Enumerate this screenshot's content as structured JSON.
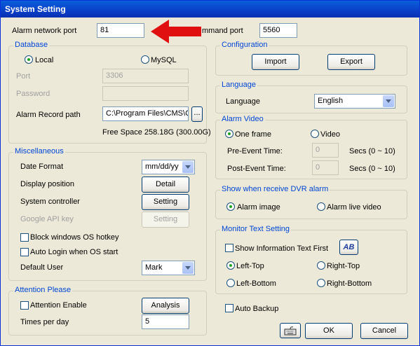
{
  "window": {
    "title": "System Setting"
  },
  "alarm_port": {
    "label": "Alarm network port",
    "value": "81"
  },
  "command_port": {
    "label": "mmand port",
    "value": "5560"
  },
  "database": {
    "title": "Database",
    "local_label": "Local",
    "mysql_label": "MySQL",
    "port_label": "Port",
    "port_value": "3306",
    "password_label": "Password",
    "record_path_label": "Alarm Record path",
    "record_path_value": "C:\\Program Files\\CMS\\CM",
    "browse_label": "...",
    "free_space": "Free Space 258.18G (300.00G)"
  },
  "misc": {
    "title": "Miscellaneous",
    "date_format_label": "Date Format",
    "date_format_value": "mm/dd/yy",
    "display_position_label": "Display position",
    "detail_button": "Detail",
    "system_controller_label": "System controller",
    "setting_button": "Setting",
    "google_api_label": "Google API key",
    "google_setting_button": "Setting",
    "block_hotkey_label": "Block windows OS hotkey",
    "auto_login_label": "Auto Login when OS start",
    "default_user_label": "Default User",
    "default_user_value": "Mark"
  },
  "attention": {
    "title": "Attention Please",
    "enable_label": "Attention Enable",
    "analysis_button": "Analysis",
    "times_label": "Times per day",
    "times_value": "5"
  },
  "configuration": {
    "title": "Configuration",
    "import_button": "Import",
    "export_button": "Export"
  },
  "language": {
    "title": "Language",
    "label": "Language",
    "value": "English"
  },
  "alarm_video": {
    "title": "Alarm Video",
    "one_frame_label": "One frame",
    "video_label": "Video",
    "pre_event_label": "Pre-Event Time:",
    "pre_event_value": "0",
    "pre_event_unit": "Secs  (0 ~ 10)",
    "post_event_label": "Post-Event Time:",
    "post_event_value": "0",
    "post_event_unit": "Secs  (0 ~ 10)"
  },
  "dvr_alarm": {
    "title": "Show when receive DVR alarm",
    "image_label": "Alarm image",
    "live_label": "Alarm live video"
  },
  "monitor_text": {
    "title": "Monitor Text Setting",
    "show_info_label": "Show Information Text First",
    "font_icon_text": "AB",
    "left_top": "Left-Top",
    "right_top": "Right-Top",
    "left_bottom": "Left-Bottom",
    "right_bottom": "Right-Bottom"
  },
  "auto_backup_label": "Auto Backup",
  "ok_button": "OK",
  "cancel_button": "Cancel",
  "accent_color": "#0046d5",
  "arrow_color": "#e01010"
}
